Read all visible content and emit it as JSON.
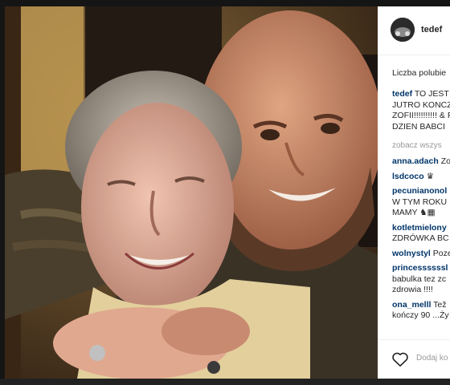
{
  "post": {
    "username": "tedef",
    "likes_label": "Liczba polubie",
    "caption": {
      "username": "tedef",
      "line1": "TO JEST",
      "line2": "JUTRO KONCZ",
      "line3": "ZOFII!!!!!!!!!! & F",
      "line4": "DZIEN BABCI"
    },
    "see_all": "zobacz wszys",
    "comments": [
      {
        "user": "anna.adach",
        "text": "Zo"
      },
      {
        "user": "lsdcoco",
        "text": "♛"
      },
      {
        "user": "pecunianonol",
        "text": "W TYM ROKU",
        "text2": "MAMY ♞▦"
      },
      {
        "user": "kotletmielony",
        "text": "ZDRÓWKA BC"
      },
      {
        "user": "wolnystyl",
        "text": "Poze"
      },
      {
        "user": "princessssssl",
        "text": "babulka tez zc",
        "text2": "zdrowia !!!!"
      },
      {
        "user": "ona_melll",
        "text": "Tež",
        "text2": "kończy 90 ...Ży"
      }
    ],
    "add_comment_placeholder": "Dodaj ko"
  },
  "icons": {
    "like": "heart-icon",
    "avatar": "avatar"
  }
}
